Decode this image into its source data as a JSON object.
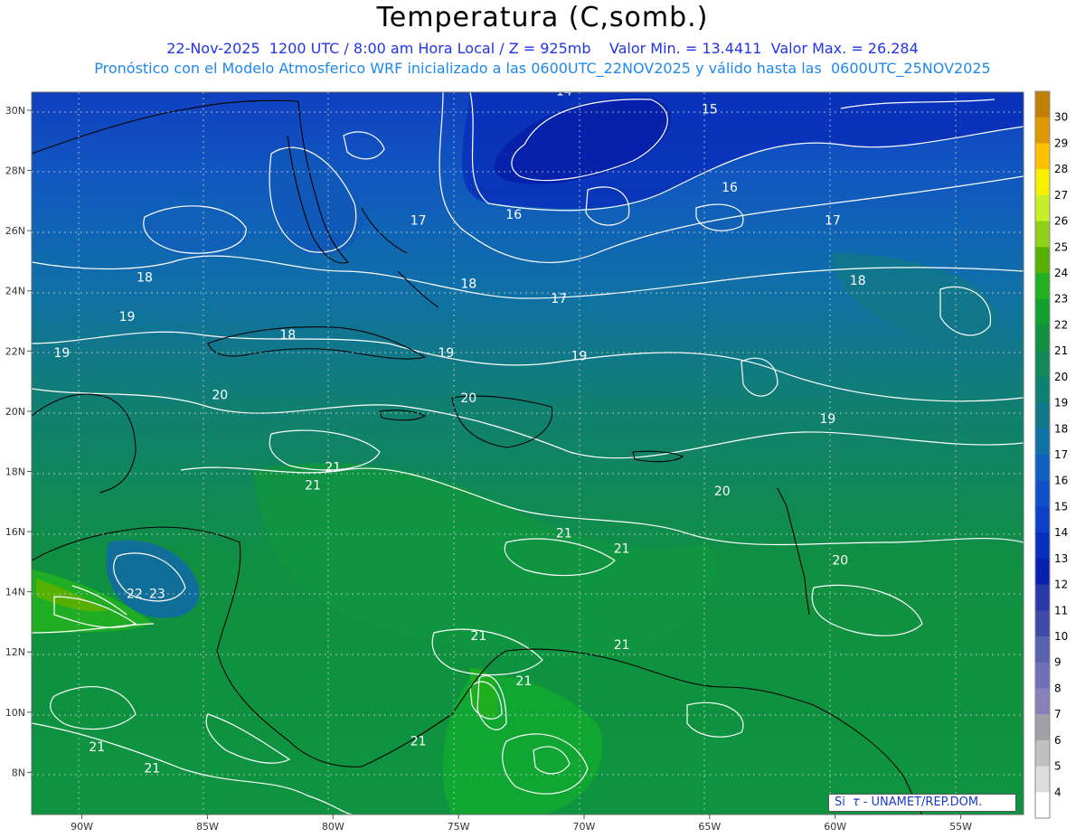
{
  "header": {
    "title": "Temperatura (C,somb.)",
    "subtitle_1": "22-Nov-2025  1200 UTC / 8:00 am Hora Local / Z = 925mb    Valor Min. = 13.4411  Valor Max. = 26.284",
    "subtitle_2": "Pronóstico con el Modelo Atmosferico WRF inicializado a las 0600UTC_22NOV2025 y válido hasta las  0600UTC_25NOV2025"
  },
  "map": {
    "lon_ticks": [
      "90W",
      "85W",
      "80W",
      "75W",
      "70W",
      "65W",
      "60W",
      "55W"
    ],
    "lat_ticks": [
      "30N",
      "28N",
      "26N",
      "24N",
      "22N",
      "20N",
      "18N",
      "16N",
      "14N",
      "12N",
      "10N",
      "8N"
    ],
    "contour_labels": [
      {
        "text": "14",
        "lon": -70.8,
        "lat": 30.5
      },
      {
        "text": "15",
        "lon": -65.0,
        "lat": 29.9
      },
      {
        "text": "16",
        "lon": -64.2,
        "lat": 27.3
      },
      {
        "text": "16",
        "lon": -72.8,
        "lat": 26.4
      },
      {
        "text": "17",
        "lon": -76.6,
        "lat": 26.2
      },
      {
        "text": "17",
        "lon": -60.1,
        "lat": 26.2
      },
      {
        "text": "17",
        "lon": -71.0,
        "lat": 23.6
      },
      {
        "text": "18",
        "lon": -87.5,
        "lat": 24.3
      },
      {
        "text": "18",
        "lon": -74.6,
        "lat": 24.1
      },
      {
        "text": "18",
        "lon": -59.1,
        "lat": 24.2
      },
      {
        "text": "18",
        "lon": -81.8,
        "lat": 22.4
      },
      {
        "text": "19",
        "lon": -88.2,
        "lat": 23.0
      },
      {
        "text": "19",
        "lon": -90.8,
        "lat": 21.8
      },
      {
        "text": "19",
        "lon": -75.5,
        "lat": 21.8
      },
      {
        "text": "19",
        "lon": -70.2,
        "lat": 21.7
      },
      {
        "text": "19",
        "lon": -60.3,
        "lat": 19.6
      },
      {
        "text": "20",
        "lon": -84.5,
        "lat": 20.4
      },
      {
        "text": "20",
        "lon": -74.6,
        "lat": 20.3
      },
      {
        "text": "20",
        "lon": -64.5,
        "lat": 17.2
      },
      {
        "text": "20",
        "lon": -59.8,
        "lat": 14.9
      },
      {
        "text": "21",
        "lon": -80.0,
        "lat": 18.0
      },
      {
        "text": "21",
        "lon": -80.8,
        "lat": 17.4
      },
      {
        "text": "21",
        "lon": -70.8,
        "lat": 15.8
      },
      {
        "text": "21",
        "lon": -68.5,
        "lat": 15.3
      },
      {
        "text": "21",
        "lon": -74.2,
        "lat": 12.4
      },
      {
        "text": "21",
        "lon": -68.5,
        "lat": 12.1
      },
      {
        "text": "21",
        "lon": -72.4,
        "lat": 10.9
      },
      {
        "text": "21",
        "lon": -76.6,
        "lat": 8.9
      },
      {
        "text": "21",
        "lon": -89.4,
        "lat": 8.7
      },
      {
        "text": "21",
        "lon": -87.2,
        "lat": 8.0
      },
      {
        "text": "22",
        "lon": -87.9,
        "lat": 13.8
      },
      {
        "text": "23",
        "lon": -87.0,
        "lat": 13.8
      }
    ]
  },
  "colorbar": {
    "levels": [
      {
        "label": "30",
        "color": "#c08000"
      },
      {
        "label": "29",
        "color": "#e09800"
      },
      {
        "label": "28",
        "color": "#ffc000"
      },
      {
        "label": "27",
        "color": "#f8f000"
      },
      {
        "label": "26",
        "color": "#c8f028"
      },
      {
        "label": "25",
        "color": "#90d018"
      },
      {
        "label": "24",
        "color": "#58b000"
      },
      {
        "label": "23",
        "color": "#20b020"
      },
      {
        "label": "22",
        "color": "#10a030"
      },
      {
        "label": "21",
        "color": "#109040"
      },
      {
        "label": "20",
        "color": "#108858"
      },
      {
        "label": "19",
        "color": "#108070"
      },
      {
        "label": "18",
        "color": "#107888"
      },
      {
        "label": "17",
        "color": "#1070a8"
      },
      {
        "label": "16",
        "color": "#1060c0"
      },
      {
        "label": "15",
        "color": "#1050c8"
      },
      {
        "label": "14",
        "color": "#0c40c8"
      },
      {
        "label": "13",
        "color": "#0830c0"
      },
      {
        "label": "12",
        "color": "#0820b0"
      },
      {
        "label": "11",
        "color": "#2838a8"
      },
      {
        "label": "10",
        "color": "#4048a8"
      },
      {
        "label": "9",
        "color": "#5860b0"
      },
      {
        "label": "8",
        "color": "#7070b8"
      },
      {
        "label": "7",
        "color": "#8880b8"
      },
      {
        "label": "6",
        "color": "#a0a0a8"
      },
      {
        "label": "5",
        "color": "#c0c0c0"
      },
      {
        "label": "4",
        "color": "#dcdcdc"
      },
      {
        "label": "",
        "color": "#ffffff"
      }
    ]
  },
  "credit": {
    "left": "Si",
    "tau": "τ",
    "right": "- UNAMET/REP.DOM."
  }
}
